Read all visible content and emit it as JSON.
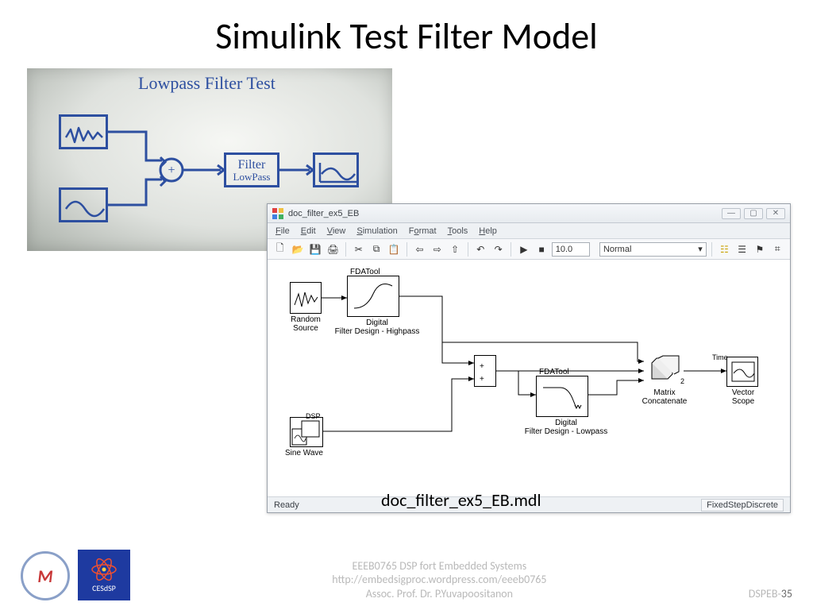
{
  "slide": {
    "title": "Simulink Test Filter Model"
  },
  "whiteboard": {
    "heading": "Lowpass Filter Test",
    "filter_line1": "Filter",
    "filter_line2": "LowPass"
  },
  "simulink": {
    "window_title": "doc_filter_ex5_EB",
    "menus": {
      "file": "File",
      "edit": "Edit",
      "view": "View",
      "simulation": "Simulation",
      "format": "Format",
      "tools": "Tools",
      "help": "Help"
    },
    "toolbar": {
      "stop_time": "10.0",
      "mode": "Normal"
    },
    "blocks": {
      "random_source": "Random\nSource",
      "fdatool": "FDATool",
      "highpass": "Digital\nFilter Design - Highpass",
      "lowpass": "Digital\nFilter Design - Lowpass",
      "dsp": "DSP",
      "sine_wave": "Sine Wave",
      "matrix_concat": "Matrix\nConcatenate",
      "concat_port": "2",
      "vector_scope": "Vector\nScope",
      "time": "Time"
    },
    "status": {
      "ready": "Ready",
      "solver": "FixedStepDiscrete"
    }
  },
  "filename_overlay": "doc_filter_ex5_EB.mdl",
  "footer": {
    "line1": "EEEB0765  DSP fort Embedded Systems",
    "line2": "http://embedsigproc.wordpress.com/eeeb0765",
    "line3": "Assoc. Prof. Dr. P.Yuvapoositanon",
    "course_code": "DSPEB",
    "page": "35",
    "cesdsp": "CESdSP"
  }
}
